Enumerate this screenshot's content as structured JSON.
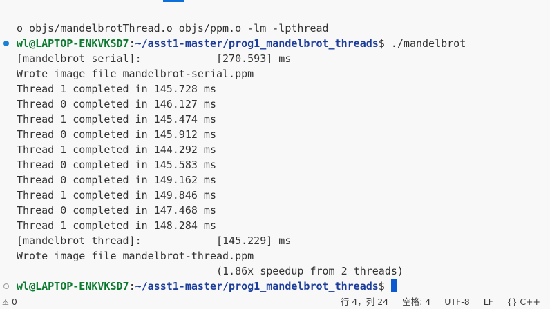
{
  "terminal": {
    "lines": [
      {
        "text": "o objs/mandelbrotThread.o objs/ppm.o -lm -lpthread"
      },
      {
        "prompt_user": "wl@LAPTOP-ENKVKSD7",
        "prompt_colon": ":",
        "prompt_path": "~/asst1-master/prog1_mandelbrot_threads",
        "prompt_symbol": "$ ",
        "command": "./mandelbrot"
      },
      {
        "text": "[mandelbrot serial]:            [270.593] ms"
      },
      {
        "text": "Wrote image file mandelbrot-serial.ppm"
      },
      {
        "text": "Thread 1 completed in 145.728 ms"
      },
      {
        "text": "Thread 0 completed in 146.127 ms"
      },
      {
        "text": "Thread 1 completed in 145.474 ms"
      },
      {
        "text": "Thread 0 completed in 145.912 ms"
      },
      {
        "text": "Thread 1 completed in 144.292 ms"
      },
      {
        "text": "Thread 0 completed in 145.583 ms"
      },
      {
        "text": "Thread 0 completed in 149.162 ms"
      },
      {
        "text": "Thread 1 completed in 149.846 ms"
      },
      {
        "text": "Thread 0 completed in 147.468 ms"
      },
      {
        "text": "Thread 1 completed in 148.284 ms"
      },
      {
        "text": "[mandelbrot thread]:            [145.229] ms"
      },
      {
        "text": "Wrote image file mandelbrot-thread.ppm"
      },
      {
        "text": "                                (1.86x speedup from 2 threads)"
      },
      {
        "prompt_user": "wl@LAPTOP-ENKVKSD7",
        "prompt_colon": ":",
        "prompt_path": "~/asst1-master/prog1_mandelbrot_threads",
        "prompt_symbol": "$ ",
        "command": ""
      }
    ],
    "colors": {
      "user": "#0a7a2f",
      "path": "#1c3d9c",
      "cursor": "#0a5bd0",
      "decoration_success": "#1b80d6"
    }
  },
  "statusbar": {
    "warnings_icon": "warning-icon",
    "warnings_count": "0",
    "position": "行 4，列 24",
    "indent": "空格: 4",
    "encoding": "UTF-8",
    "eol": "LF",
    "language_icon": "braces-icon",
    "language": "C++"
  }
}
